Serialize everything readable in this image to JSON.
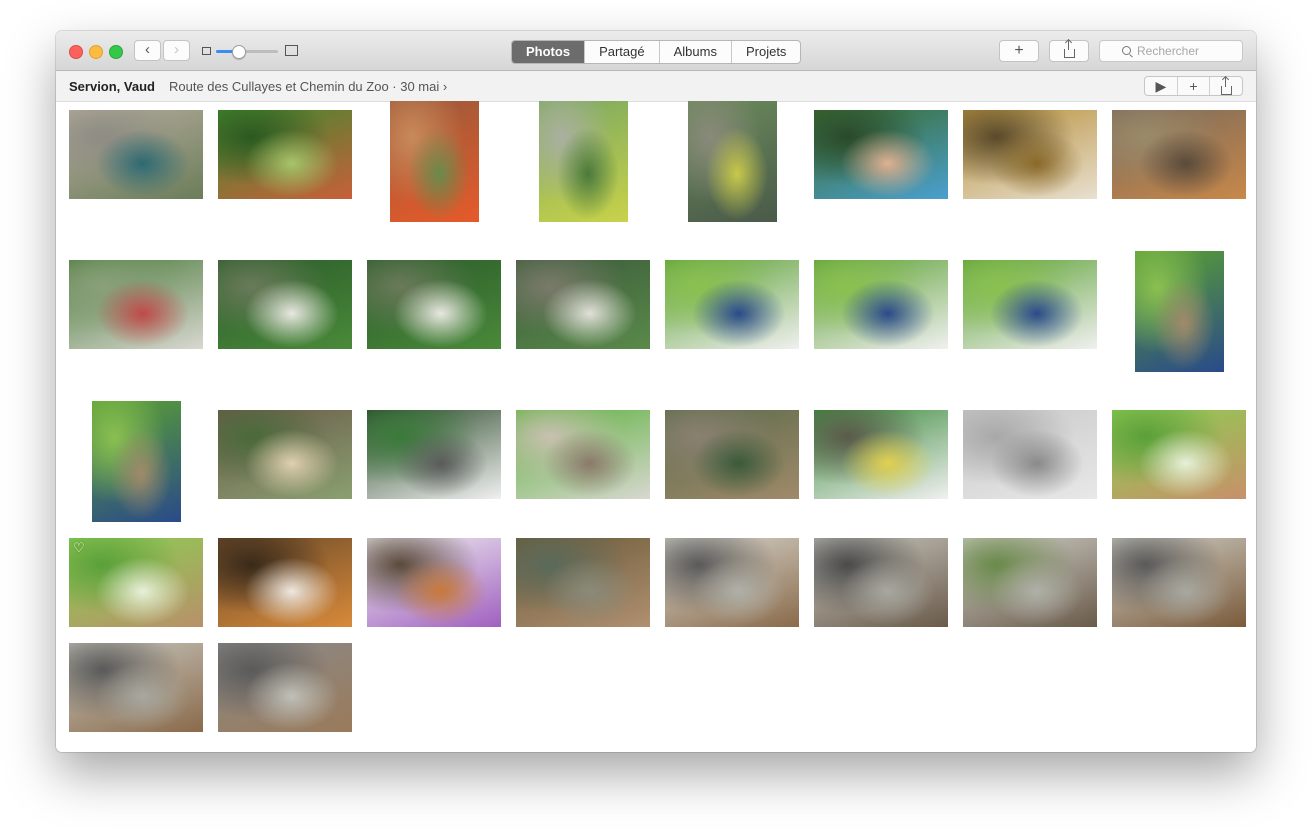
{
  "window": {
    "nav_back": "‹",
    "nav_forward": "›",
    "zoom_level": 0.35,
    "tabs": [
      {
        "label": "Photos",
        "active": true
      },
      {
        "label": "Partagé",
        "active": false
      },
      {
        "label": "Albums",
        "active": false
      },
      {
        "label": "Projets",
        "active": false
      }
    ],
    "add_label": "+",
    "search_placeholder": "Rechercher"
  },
  "moment": {
    "title": "Servion, Vaud",
    "subtitle": "Route des Cullayes et Chemin du Zoo  ·  30 mai ›",
    "play_label": "▶",
    "add_label": "+"
  },
  "photos": [
    {
      "subject": "peacock",
      "orientation": "landscape",
      "favorite": false,
      "colors": [
        "#b7ad9d",
        "#6b7d5a",
        "#2d6a73",
        "#8e8c84"
      ]
    },
    {
      "subject": "child on slide",
      "orientation": "landscape",
      "favorite": false,
      "colors": [
        "#3f8a2f",
        "#c85f3a",
        "#a7c46a",
        "#2a5a20"
      ]
    },
    {
      "subject": "child on playground",
      "orientation": "portrait",
      "favorite": false,
      "colors": [
        "#9a5a3a",
        "#e65a2a",
        "#6a8a4a",
        "#c88a5a"
      ]
    },
    {
      "subject": "child with bubbles",
      "orientation": "portrait",
      "favorite": false,
      "colors": [
        "#7aa860",
        "#c9d24a",
        "#4a7a3a",
        "#aab0a0"
      ]
    },
    {
      "subject": "child in park",
      "orientation": "portrait",
      "favorite": false,
      "colors": [
        "#6a8a5a",
        "#4a5a4a",
        "#c8c84a",
        "#8a8a7a"
      ]
    },
    {
      "subject": "mother and child",
      "orientation": "landscape",
      "favorite": false,
      "colors": [
        "#3a6a2a",
        "#4aa0d0",
        "#e0b090",
        "#2a4a2a"
      ]
    },
    {
      "subject": "guinea pigs",
      "orientation": "landscape",
      "favorite": false,
      "colors": [
        "#b8903a",
        "#e8e0d0",
        "#8a6a2a",
        "#5a4a2a"
      ]
    },
    {
      "subject": "sleeping pony",
      "orientation": "landscape",
      "favorite": false,
      "colors": [
        "#7a6a5a",
        "#c8884a",
        "#5a4a3a",
        "#9a8a6a"
      ]
    },
    {
      "subject": "child on path",
      "orientation": "landscape",
      "favorite": false,
      "colors": [
        "#4a7a3a",
        "#d8d8d0",
        "#c04a4a",
        "#8aa07a"
      ]
    },
    {
      "subject": "white wolf",
      "orientation": "landscape",
      "favorite": false,
      "colors": [
        "#2a5a2a",
        "#4a8a3a",
        "#e8e8e0",
        "#6a7a5a"
      ]
    },
    {
      "subject": "white wolf",
      "orientation": "landscape",
      "favorite": false,
      "colors": [
        "#2a5a2a",
        "#4a8a3a",
        "#e8e8e0",
        "#6a7a5a"
      ]
    },
    {
      "subject": "white wolf resting",
      "orientation": "landscape",
      "favorite": false,
      "colors": [
        "#3a5a3a",
        "#5a8a4a",
        "#e0e0d8",
        "#7a7a6a"
      ]
    },
    {
      "subject": "two children",
      "orientation": "landscape",
      "favorite": false,
      "colors": [
        "#5aa032",
        "#f0f0f0",
        "#2a4a8a",
        "#8ac050"
      ]
    },
    {
      "subject": "two children",
      "orientation": "landscape",
      "favorite": false,
      "colors": [
        "#5aa032",
        "#f0f0f0",
        "#2a4a8a",
        "#8ac050"
      ]
    },
    {
      "subject": "two children",
      "orientation": "landscape",
      "favorite": false,
      "colors": [
        "#5aa032",
        "#f0f0f0",
        "#2a4a8a",
        "#8ac050"
      ]
    },
    {
      "subject": "children on stump",
      "orientation": "portrait",
      "favorite": false,
      "colors": [
        "#5aa032",
        "#2a4a8a",
        "#a08a6a",
        "#8ac050"
      ]
    },
    {
      "subject": "children on stump",
      "orientation": "portrait",
      "favorite": false,
      "colors": [
        "#5aa032",
        "#2a4a8a",
        "#a08a6a",
        "#8ac050"
      ]
    },
    {
      "subject": "feeding goats",
      "orientation": "landscape",
      "favorite": false,
      "colors": [
        "#6a5a4a",
        "#8aa070",
        "#e0d0b0",
        "#4a6a3a"
      ]
    },
    {
      "subject": "children at fence",
      "orientation": "landscape",
      "favorite": false,
      "colors": [
        "#2a4a2a",
        "#f0f0f0",
        "#5a5a5a",
        "#3a7a3a"
      ]
    },
    {
      "subject": "goats on meadow",
      "orientation": "landscape",
      "favorite": false,
      "colors": [
        "#5ab03a",
        "#d8d8d0",
        "#8a7a6a",
        "#c8c0b0"
      ]
    },
    {
      "subject": "ibexes on rocks",
      "orientation": "landscape",
      "favorite": false,
      "colors": [
        "#5a6a4a",
        "#a08a6a",
        "#3a5a3a",
        "#8a8070"
      ]
    },
    {
      "subject": "child and goat",
      "orientation": "landscape",
      "favorite": false,
      "colors": [
        "#3a8a3a",
        "#f0f0f0",
        "#e0d050",
        "#5a5a4a"
      ]
    },
    {
      "subject": "snow leopard",
      "orientation": "landscape",
      "favorite": false,
      "colors": [
        "#c8c8c8",
        "#e8e8e8",
        "#8a8a8a",
        "#a8a8a8"
      ]
    },
    {
      "subject": "lioness",
      "orientation": "landscape",
      "favorite": false,
      "colors": [
        "#8ad050",
        "#c8906a",
        "#e8f0d8",
        "#5aa03a"
      ]
    },
    {
      "subject": "lioness",
      "orientation": "landscape",
      "favorite": true,
      "colors": [
        "#8ad050",
        "#b8906a",
        "#e8f0d8",
        "#5aa03a"
      ]
    },
    {
      "subject": "tiger",
      "orientation": "landscape",
      "favorite": false,
      "colors": [
        "#6a4a2a",
        "#d88a3a",
        "#f0e8e0",
        "#3a2a1a"
      ]
    },
    {
      "subject": "tiger with toy",
      "orientation": "landscape",
      "favorite": false,
      "colors": [
        "#f0f0f0",
        "#a060c0",
        "#c87a3a",
        "#5a4a3a"
      ]
    },
    {
      "subject": "brown bear",
      "orientation": "landscape",
      "favorite": false,
      "colors": [
        "#6a5a3a",
        "#b09070",
        "#8a8a7a",
        "#5a6a5a"
      ]
    },
    {
      "subject": "bear on rocks",
      "orientation": "landscape",
      "favorite": false,
      "colors": [
        "#d8d8d0",
        "#8a6a4a",
        "#b0b0a8",
        "#5a5a5a"
      ]
    },
    {
      "subject": "bear cub",
      "orientation": "landscape",
      "favorite": false,
      "colors": [
        "#c8c8c0",
        "#6a5a4a",
        "#a8a8a0",
        "#4a4a4a"
      ]
    },
    {
      "subject": "bear cub",
      "orientation": "landscape",
      "favorite": false,
      "colors": [
        "#d0d0c8",
        "#6a5a4a",
        "#b0b0a8",
        "#6a8a4a"
      ]
    },
    {
      "subject": "bear and cub",
      "orientation": "landscape",
      "favorite": false,
      "colors": [
        "#d0d0c8",
        "#7a5a3a",
        "#a8a8a0",
        "#5a5a5a"
      ]
    },
    {
      "subject": "bear and cub",
      "orientation": "landscape",
      "favorite": false,
      "colors": [
        "#c8c8c0",
        "#8a6a4a",
        "#a8a8a0",
        "#5a5a5a"
      ]
    },
    {
      "subject": "bear and cub",
      "orientation": "landscape",
      "favorite": false,
      "colors": [
        "#8a8a8a",
        "#9a7a5a",
        "#c0c0b8",
        "#5a5a5a"
      ]
    }
  ]
}
